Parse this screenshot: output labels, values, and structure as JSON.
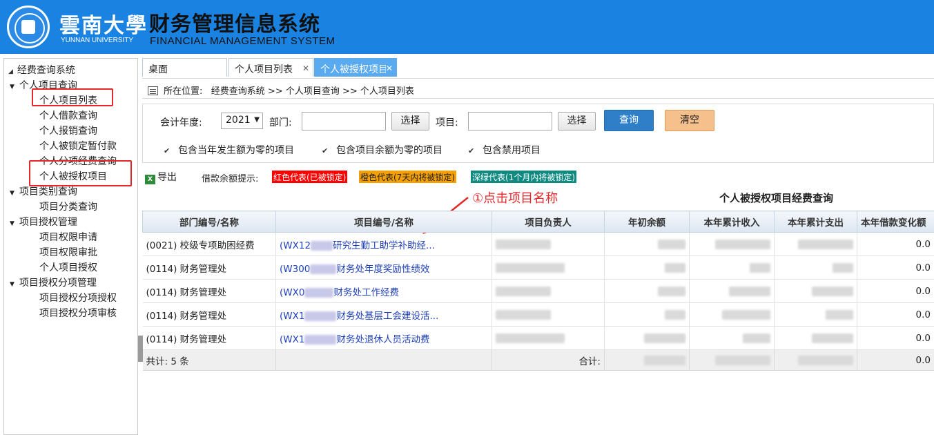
{
  "header": {
    "university_cn": "雲南大學",
    "university_en": "YUNNAN UNIVERSITY",
    "title": "财务管理信息系统",
    "subtitle": "FINANCIAL MANAGEMENT SYSTEM"
  },
  "sidebar": {
    "root": "经费查询系统",
    "groups": [
      {
        "label": "个人项目查询",
        "items": [
          "个人项目列表",
          "个人借款查询",
          "个人报销查询",
          "个人被锁定暂付款",
          "个人分项经费查询",
          "个人被授权项目"
        ]
      },
      {
        "label": "项目类别查询",
        "items": [
          "项目分类查询"
        ]
      },
      {
        "label": "项目授权管理",
        "items": [
          "项目权限申请",
          "项目权限审批",
          "个人项目授权"
        ]
      },
      {
        "label": "项目授权分项管理",
        "items": [
          "项目授权分项授权",
          "项目授权分项审核"
        ]
      }
    ]
  },
  "tabs": [
    {
      "label": "桌面"
    },
    {
      "label": "个人项目列表"
    },
    {
      "label": "个人被授权项目"
    }
  ],
  "breadcrumb": {
    "prefix": "所在位置:",
    "path": "经费查询系统 >> 个人项目查询 >> 个人项目列表"
  },
  "filter": {
    "year_label": "会计年度:",
    "year_value": "2021",
    "dept_label": "部门:",
    "dept_value": "",
    "select_btn": "选择",
    "project_label": "项目:",
    "project_value": "",
    "search_btn": "查询",
    "clear_btn": "清空",
    "checkboxes": [
      "包含当年发生额为零的项目",
      "包含项目余额为零的项目",
      "包含禁用项目"
    ]
  },
  "export_label": "导出",
  "legend": {
    "label": "借款余额提示:",
    "red": "红色代表(已被锁定)",
    "orange": "橙色代表(7天内将被锁定)",
    "teal": "深绿代表(1个月内将被锁定)",
    "colors": {
      "red": "#ff0000",
      "orange": "#f5a000",
      "teal": "#0f8a80"
    }
  },
  "table_title": "个人被授权项目经费查询",
  "annotation": "①点击项目名称",
  "table": {
    "headers": [
      "部门编号/名称",
      "项目编号/名称",
      "项目负责人",
      "年初余额",
      "本年累计收入",
      "本年累计支出",
      "本年借款变化额"
    ],
    "rows": [
      {
        "dept": "(0021) 校级专项助困经费",
        "proj_code": "(WX12",
        "proj_name": "研究生勤工助学补助经...",
        "borrow": "0.0"
      },
      {
        "dept": "(0114) 财务管理处",
        "proj_code": "(W300",
        "proj_name": "财务处年度奖励性绩效",
        "borrow": "0.0"
      },
      {
        "dept": "(0114) 财务管理处",
        "proj_code": "(WX0",
        "proj_name": "财务处工作经费",
        "borrow": "0.0"
      },
      {
        "dept": "(0114) 财务管理处",
        "proj_code": "(WX1",
        "proj_name": "财务处基层工会建设活...",
        "borrow": "0.0"
      },
      {
        "dept": "(0114) 财务管理处",
        "proj_code": "(WX1",
        "proj_name": "财务处退休人员活动费",
        "borrow": "0.0"
      }
    ],
    "footer": {
      "count": "共计: 5 条",
      "total_label": "合计:",
      "borrow_total": "0.0"
    }
  }
}
